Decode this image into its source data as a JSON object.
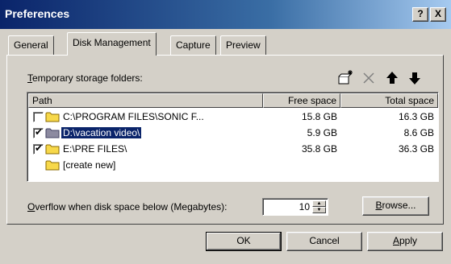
{
  "window": {
    "title": "Preferences",
    "help_label": "?",
    "close_label": "X"
  },
  "tabs": [
    {
      "label": "General"
    },
    {
      "label": "Disk Management",
      "active": true
    },
    {
      "label": "Capture"
    },
    {
      "label": "Preview"
    }
  ],
  "folders": {
    "label_access": "T",
    "label_rest": "emporary storage folders:",
    "toolbar": [
      "new-folder-icon",
      "delete-icon",
      "move-up-arrow-icon",
      "move-down-arrow-icon"
    ],
    "columns": {
      "path": "Path",
      "free": "Free space",
      "total": "Total space"
    },
    "rows": [
      {
        "checked": false,
        "path": "C:\\PROGRAM FILES\\SONIC F...",
        "free": "15.8 GB",
        "total": "16.3 GB",
        "selected": false,
        "icon": "folder-icon"
      },
      {
        "checked": true,
        "path": "D:\\vacation video\\",
        "free": "5.9 GB",
        "total": "8.6 GB",
        "selected": true,
        "icon": "folder-icon"
      },
      {
        "checked": true,
        "path": "E:\\PRE FILES\\",
        "free": "35.8 GB",
        "total": "36.3 GB",
        "selected": false,
        "icon": "folder-icon"
      },
      {
        "checked": null,
        "path": "[create new]",
        "free": "",
        "total": "",
        "selected": false,
        "icon": "folder-icon"
      }
    ]
  },
  "overflow": {
    "label_access": "O",
    "label_rest": "verflow when disk space below (Megabytes):",
    "value": "10"
  },
  "buttons": {
    "browse_access": "B",
    "browse_rest": "rowse...",
    "ok": "OK",
    "cancel": "Cancel",
    "apply_access": "A",
    "apply_rest": "pply"
  },
  "check_mark": "✔",
  "colors": {
    "selection": "#0a246a",
    "dialog_face": "#d4d0c8",
    "folder": "#f7d84a"
  }
}
